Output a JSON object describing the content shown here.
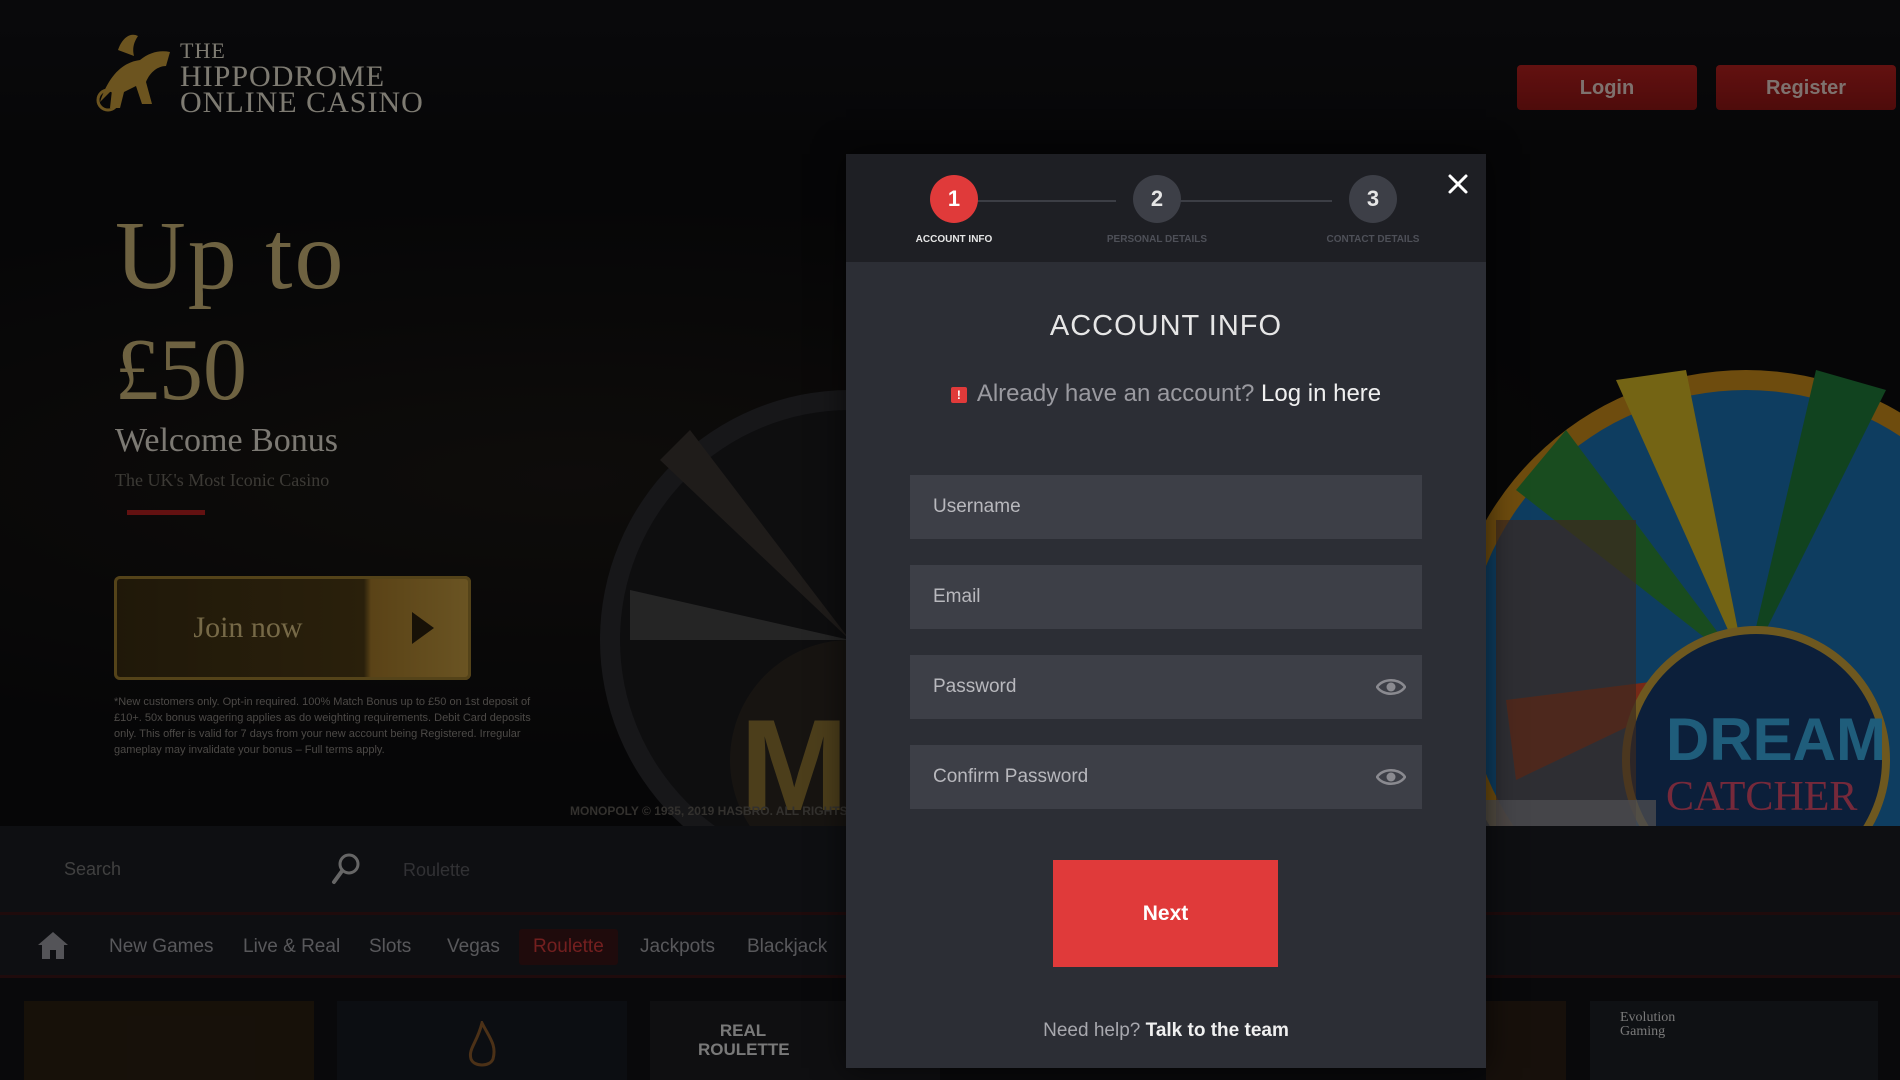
{
  "header": {
    "logo_line1": "THE",
    "logo_line2": "HIPPODROME",
    "logo_line3": "ONLINE CASINO",
    "login_label": "Login",
    "register_label": "Register"
  },
  "hero": {
    "upto": "Up to",
    "amount": "£50",
    "welcome": "Welcome Bonus",
    "tagline": "The UK's Most Iconic Casino",
    "join_label": "Join now",
    "terms": "*New customers only. Opt-in required. 100% Match Bonus up to £50 on 1st deposit of £10+. 50x bonus wagering applies as do weighting requirements. Debit Card deposits only. This offer is valid for 7 days from your new account being Registered. Irregular gameplay may invalidate your bonus – Full terms apply.",
    "copyright": "MONOPOLY © 1935, 2019 HASBRO. ALL RIGHTS"
  },
  "search": {
    "placeholder": "Search",
    "tag": "Roulette"
  },
  "nav": {
    "items": [
      "New Games",
      "Live & Real",
      "Slots",
      "Vegas",
      "Roulette",
      "Jackpots",
      "Blackjack"
    ],
    "active": "Roulette"
  },
  "games": {
    "tile3_text": "REAL ROULETTE",
    "tile_last_text": "Evolution Gaming"
  },
  "modal": {
    "steps": [
      {
        "number": "1",
        "label": "ACCOUNT INFO"
      },
      {
        "number": "2",
        "label": "PERSONAL DETAILS"
      },
      {
        "number": "3",
        "label": "CONTACT DETAILS"
      }
    ],
    "title": "ACCOUNT INFO",
    "have_account": "Already have an account?",
    "login_link": "Log in here",
    "fields": {
      "username": "Username",
      "email": "Email",
      "password": "Password",
      "confirm_password": "Confirm Password"
    },
    "next_label": "Next",
    "help_prefix": "Need help?",
    "help_link": "Talk to the team"
  },
  "colors": {
    "accent_red": "#e03a3a",
    "gold": "#c8b377",
    "modal_bg": "#2c2e35",
    "field_bg": "#3d3f47"
  }
}
